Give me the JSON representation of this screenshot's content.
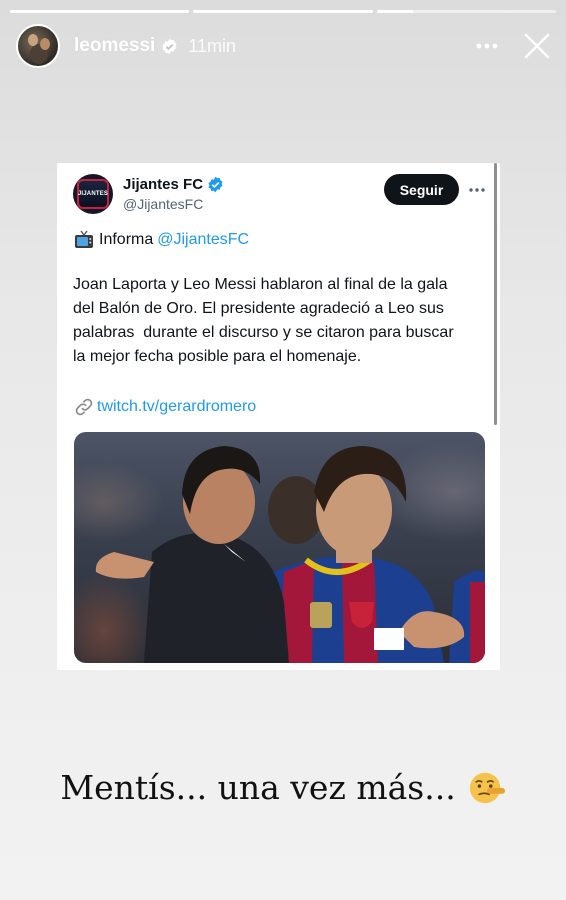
{
  "story": {
    "progress": [
      1,
      1,
      0.2
    ],
    "username": "leomessi",
    "time": "11min"
  },
  "tweet": {
    "name": "Jijantes FC",
    "handle": "@JijantesFC",
    "follow_label": "Seguir",
    "informa_label": "Informa",
    "informa_mention": "@JijantesFC",
    "body_lines": [
      "Joan Laporta y Leo Messi hablaron al final de la gala",
      "del Balón de Oro. El presidente agradeció a Leo sus",
      "palabras  durante el discurso y se citaron para buscar",
      "la mejor fecha posible para el homenaje."
    ],
    "link": "twitch.tv/gerardromero",
    "avatar_text": "JIJANTES"
  },
  "caption": "Mentís... una vez más...",
  "colors": {
    "accent": "#1d9bf0",
    "button": "#0f1419",
    "barca_blue": "#1c3f8f",
    "barca_red": "#a3183a"
  },
  "icons": {
    "verified": "verified-badge-icon",
    "more": "more-dots-icon",
    "close": "close-icon",
    "tv": "tv-emoji-icon",
    "link": "link-chain-icon",
    "emoji": "lying-face-emoji-icon"
  }
}
